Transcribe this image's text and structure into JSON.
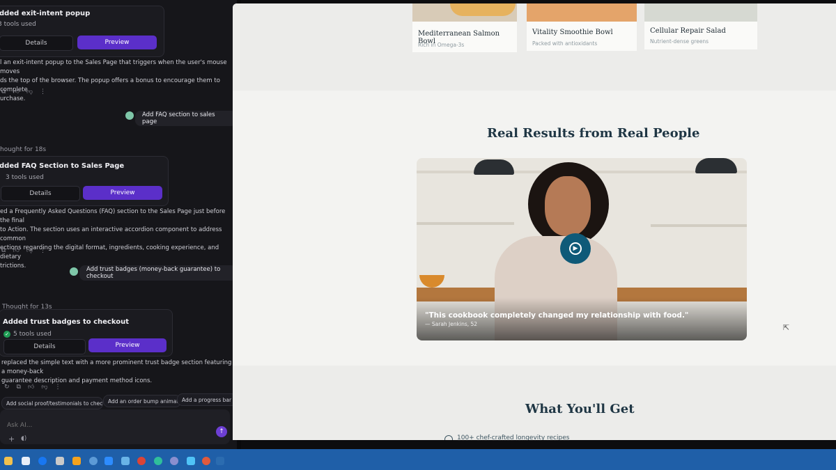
{
  "left_panel": {
    "card1": {
      "title": "dded exit-intent popup",
      "tools": "3 tools used",
      "details": "Details",
      "preview": "Preview"
    },
    "para1": [
      "l an exit-intent popup to the Sales Page that triggers when the user's mouse moves",
      "ds the top of the browser. The popup offers a bonus to encourage them to complete",
      "urchase."
    ],
    "msg1": "Add FAQ section to sales page",
    "thought2": "hought for 18s",
    "card2": {
      "title": "dded FAQ Section to Sales Page",
      "tools": "3 tools used",
      "details": "Details",
      "preview": "Preview"
    },
    "para2": [
      "ed a Frequently Asked Questions (FAQ) section to the Sales Page just before the final",
      "to Action. The section uses an interactive accordion component to address common",
      "ections regarding the digital format, ingredients, cooking experience, and dietary",
      "trictions."
    ],
    "msg2": "Add trust badges (money-back guarantee) to checkout",
    "thought3": "Thought for 13s",
    "card3": {
      "title": "Added trust badges to checkout",
      "tools": "5 tools used",
      "details": "Details",
      "preview": "Preview"
    },
    "para3": [
      "replaced the simple text with a more prominent trust badge section featuring a money-back",
      "guarantee description and payment method icons."
    ],
    "chips": [
      "Add social proof/testimonials to checkout",
      "Add an order bump animation",
      "Add a progress bar acro"
    ],
    "ask_placeholder": "Ask AI...",
    "icons": {
      "copy": "copy-icon",
      "like": "thumbs-up-icon",
      "dislike": "thumbs-down-icon",
      "more": "more-icon",
      "plus": "plus-icon",
      "mic": "mic-icon",
      "send": "send-icon"
    }
  },
  "preview": {
    "recipes": [
      {
        "title": "Mediterranean Salmon Bowl",
        "subtitle": "Rich in Omega-3s"
      },
      {
        "title": "Vitality Smoothie Bowl",
        "subtitle": "Packed with antioxidants"
      },
      {
        "title": "Cellular Repair Salad",
        "subtitle": "Nutrient-dense greens"
      }
    ],
    "section_title": "Real Results from Real People",
    "testimonial": {
      "quote": "\"This cookbook completely changed my relationship with food.\"",
      "author": "— Sarah Jenkins, 52"
    },
    "next_section_title": "What You'll Get",
    "next_item": "100+ chef-crafted longevity recipes"
  },
  "colors": {
    "accent": "#5b2fc9",
    "play": "#0f5a78",
    "heading": "#1f3644",
    "taskbar": "#1f5fa8"
  }
}
